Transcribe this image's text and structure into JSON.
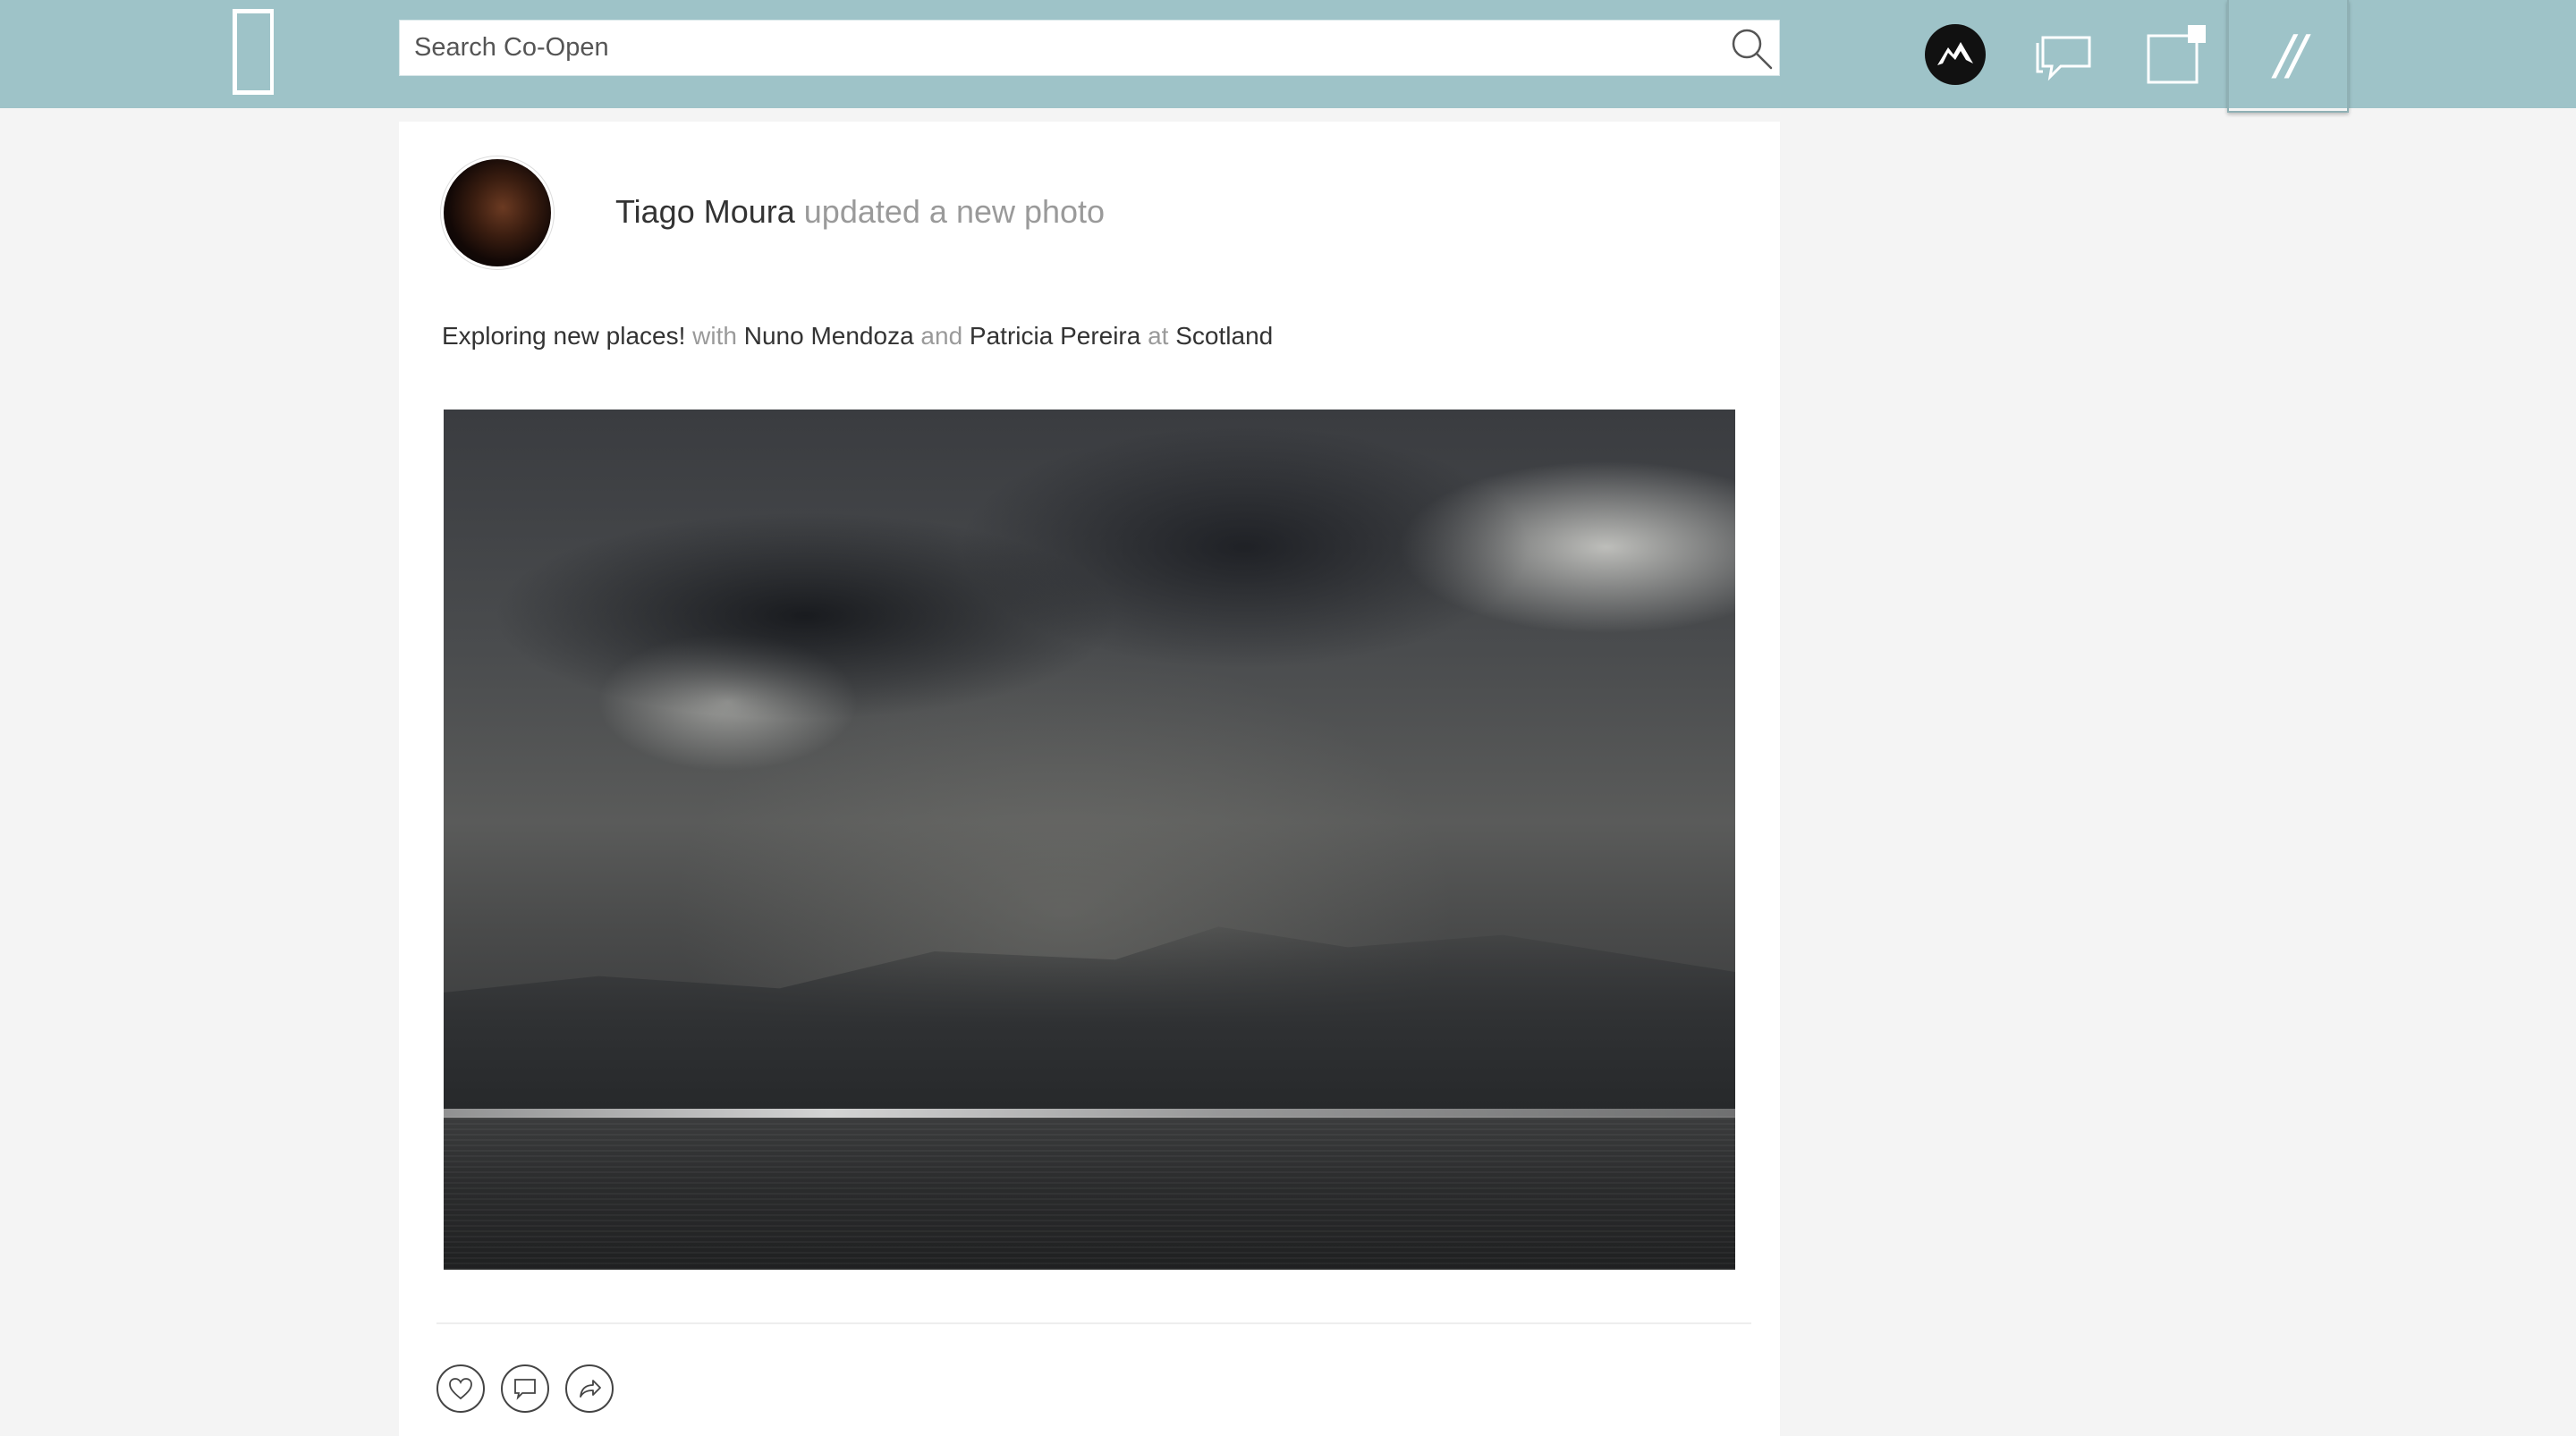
{
  "header": {
    "search_placeholder": "Search Co-Open",
    "menu_label": "//"
  },
  "post": {
    "author": "Tiago Moura",
    "action": "updated a new photo",
    "text": "Exploring new places!",
    "with_word": "with",
    "tagged_1": "Nuno Mendoza",
    "and_word": "and",
    "tagged_2": "Patricia Pereira",
    "at_word": "at",
    "location": "Scotland"
  },
  "colors": {
    "topbar": "#9ec3c8",
    "muted_text": "#9a9a9a",
    "text": "#333333"
  },
  "icons": {
    "logo": "logo-icon",
    "search": "search-icon",
    "chat": "chat-icon",
    "notifications": "notification-icon",
    "like": "heart-icon",
    "comment": "comment-icon",
    "share": "share-icon"
  }
}
